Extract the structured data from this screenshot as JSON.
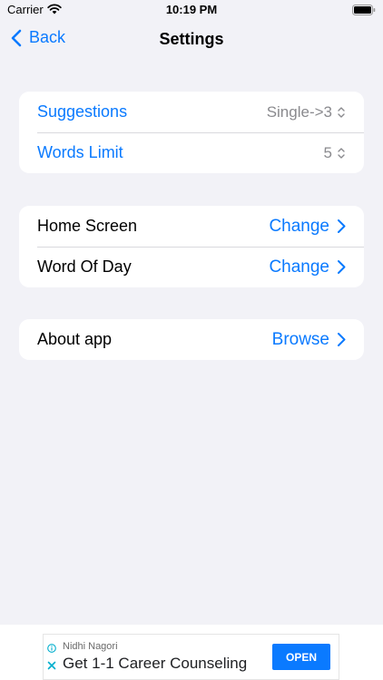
{
  "status_bar": {
    "carrier": "Carrier",
    "time": "10:19 PM"
  },
  "nav": {
    "back_label": "Back",
    "title": "Settings"
  },
  "groups": [
    {
      "rows": [
        {
          "label": "Suggestions",
          "value": "Single->3",
          "control": "updown"
        },
        {
          "label": "Words Limit",
          "value": "5",
          "control": "updown"
        }
      ]
    },
    {
      "rows": [
        {
          "label": "Home Screen",
          "value": "Change",
          "control": "chevron"
        },
        {
          "label": "Word Of Day",
          "value": "Change",
          "control": "chevron"
        }
      ]
    },
    {
      "rows": [
        {
          "label": "About app",
          "value": "Browse",
          "control": "chevron"
        }
      ]
    }
  ],
  "ad": {
    "advertiser": "Nidhi Nagori",
    "headline": "Get 1-1 Career Counseling",
    "cta": "OPEN"
  },
  "colors": {
    "accent": "#0a7aff",
    "background": "#f2f2f7",
    "secondary_text": "#8a8a8e"
  }
}
